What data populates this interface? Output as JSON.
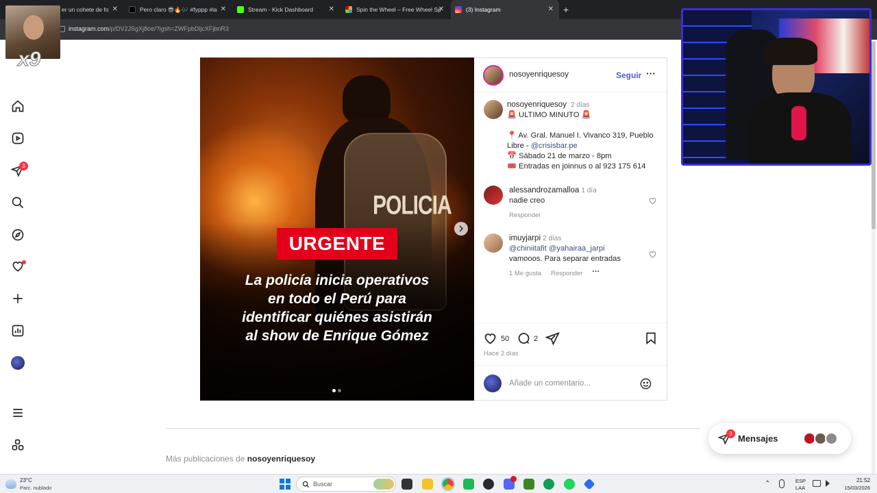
{
  "browser": {
    "tabs": [
      {
        "title": "er un cohete de fo",
        "color": "#e8e8e8"
      },
      {
        "title": "Pero claro 😎🔥🎶 #fyppp #la",
        "color": "#000000"
      },
      {
        "title": "Stream - Kick Dashboard",
        "color": "#53fc18"
      },
      {
        "title": "Spin the Wheel – Free Wheel Sp",
        "color": "#f5a623"
      },
      {
        "title": "(3) Instagram",
        "color": "#d62976"
      }
    ],
    "new_tab": "+",
    "url_domain": "instagram.com",
    "url_path": "/p/DV2JSgXj8oe/?igsh=ZWFpbDljcXFjbnR3"
  },
  "overlay": {
    "multiplier": "x9"
  },
  "sidebar": {
    "notification_count": "3",
    "icons": [
      "home-icon",
      "reels-icon",
      "messages-icon",
      "search-icon",
      "explore-icon",
      "notifications-icon",
      "create-icon",
      "dashboard-icon",
      "profile-icon",
      "more-icon",
      "also-from-meta-icon"
    ]
  },
  "post": {
    "image": {
      "headline": "URGENTE",
      "caption_lines": [
        "La policía inicia operativos",
        "en todo el Perú para",
        "identificar quiénes asistirán",
        "al show de Enrique Gómez"
      ],
      "shield_text": "POLICIA"
    },
    "header": {
      "username": "nosoyenriquesoy",
      "follow": "Seguir",
      "more": "···"
    },
    "caption": {
      "username": "nosoyenriquesoy",
      "time": "2 días",
      "line1": "🚨 ULTIMO MINUTO 🚨",
      "address": "📍 Av. Gral. Manuel I. Vivanco 319, Pueblo",
      "address2_pre": "Libre - ",
      "address2_link": "@crisisbar.pe",
      "date_line": "📅 Sábado 21 de marzo - 8pm",
      "tickets_line": "🎟️ Entradas en joinnus o al 923 175 614"
    },
    "comments": [
      {
        "username": "alessandrozamalloa",
        "time": "1 día",
        "text": "nadie creo",
        "reply": "Responder"
      },
      {
        "username": "imuyjarpi",
        "time": "2 días",
        "mentions": "@chiniitafit @yahairaa_jarpi",
        "text": "vamooos. Para separar entradas",
        "likes": "1 Me gusta",
        "reply": "Responder",
        "more": "···"
      }
    ],
    "likes": "50",
    "comments_count": "2",
    "posted": "Hace 2 días",
    "comment_placeholder": "Añade un comentario..."
  },
  "more_posts": {
    "prefix": "Más publicaciones de ",
    "username": "nosoyenriquesoy"
  },
  "messages": {
    "label": "Mensajes",
    "count": "3"
  },
  "taskbar": {
    "weather_temp": "23°C",
    "weather_desc": "Parc. nublado",
    "search": "Buscar",
    "lang1": "ESP",
    "lang2": "LAA",
    "time": "21:52",
    "date": "15/03/2026"
  },
  "colors": {
    "accent": "#0095f6",
    "follow": "#4f5bd5",
    "badge": "#ff3040",
    "headline_bg": "#e3001b"
  }
}
